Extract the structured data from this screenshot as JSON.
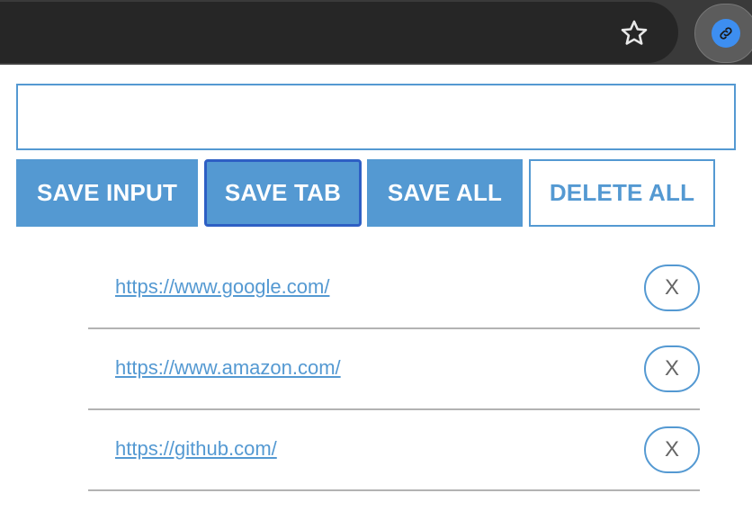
{
  "toolbar": {
    "star_icon": "star-icon",
    "extension_icon": "link-icon",
    "extension_color": "#3d8ef0"
  },
  "input": {
    "value": "",
    "placeholder": ""
  },
  "buttons": {
    "save_input": "SAVE INPUT",
    "save_tab": "SAVE TAB",
    "save_all": "SAVE ALL",
    "delete_all": "DELETE ALL"
  },
  "links": [
    {
      "url": "https://www.google.com/",
      "delete_label": "X"
    },
    {
      "url": "https://www.amazon.com/",
      "delete_label": "X"
    },
    {
      "url": "https://github.com/",
      "delete_label": "X"
    }
  ],
  "colors": {
    "accent": "#5499d2",
    "focus_border": "#2e5fc4"
  }
}
